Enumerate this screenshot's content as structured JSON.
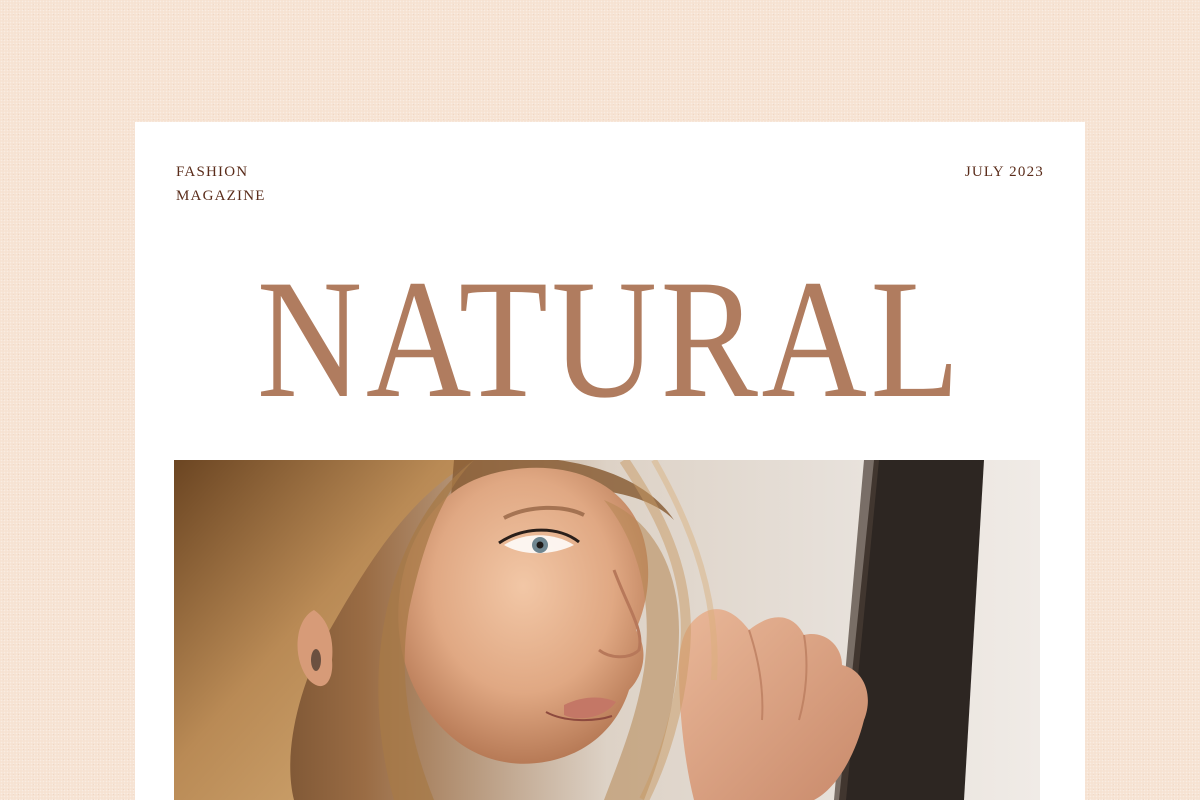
{
  "magazine": {
    "label_line1": "FASHION",
    "label_line2": "MAGAZINE",
    "issue_date": "JULY 2023",
    "cover_title": "NATURAL"
  },
  "photo": {
    "subject": "portrait of a woman in profile with wavy blonde hair",
    "icon": "portrait-photo"
  },
  "colors": {
    "background": "#f6e2d2",
    "page": "#ffffff",
    "title": "#b07c5f",
    "masthead_text": "#5a2c1a"
  }
}
